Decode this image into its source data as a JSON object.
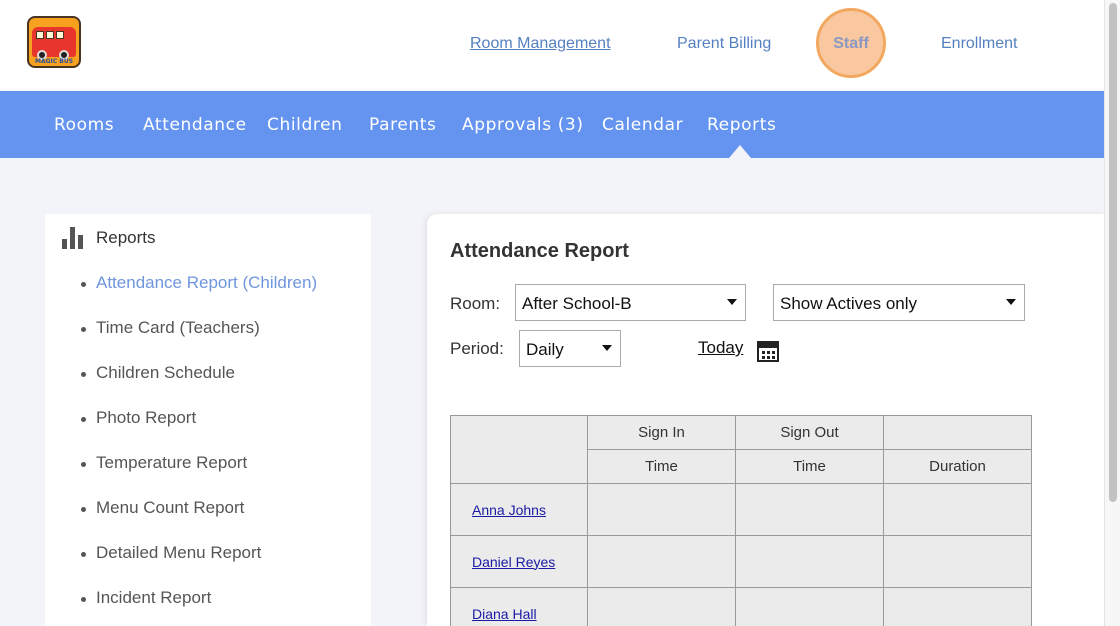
{
  "header": {
    "logo_text": "MAGIC BUS",
    "links": {
      "room_management": "Room Management",
      "parent_billing": "Parent Billing",
      "staff": "Staff",
      "enrollment": "Enrollment"
    }
  },
  "nav": {
    "items": [
      "Rooms",
      "Attendance",
      "Children",
      "Parents",
      "Approvals (3)",
      "Calendar",
      "Reports"
    ],
    "active": "Reports"
  },
  "sidebar": {
    "title": "Reports",
    "items": [
      "Attendance Report (Children)",
      "Time Card (Teachers)",
      "Children Schedule",
      "Photo Report",
      "Temperature Report",
      "Menu Count Report",
      "Detailed Menu Report",
      "Incident Report"
    ],
    "active_index": 0
  },
  "report": {
    "title": "Attendance Report",
    "room_label": "Room:",
    "room_value": "After School-B",
    "filter_value": "Show Actives only",
    "period_label": "Period:",
    "period_value": "Daily",
    "today_link": "Today",
    "table": {
      "group_headers": [
        "Sign In",
        "Sign Out"
      ],
      "sub_headers": [
        "Time",
        "Time",
        "Duration"
      ],
      "rows": [
        "Anna Johns",
        "Daniel Reyes",
        "Diana Hall"
      ]
    }
  },
  "colors": {
    "nav_bg": "#6494f0",
    "active_link": "#6f96dd",
    "staff_highlight": "#f9c8a0",
    "page_bg": "#f3f4f9"
  }
}
